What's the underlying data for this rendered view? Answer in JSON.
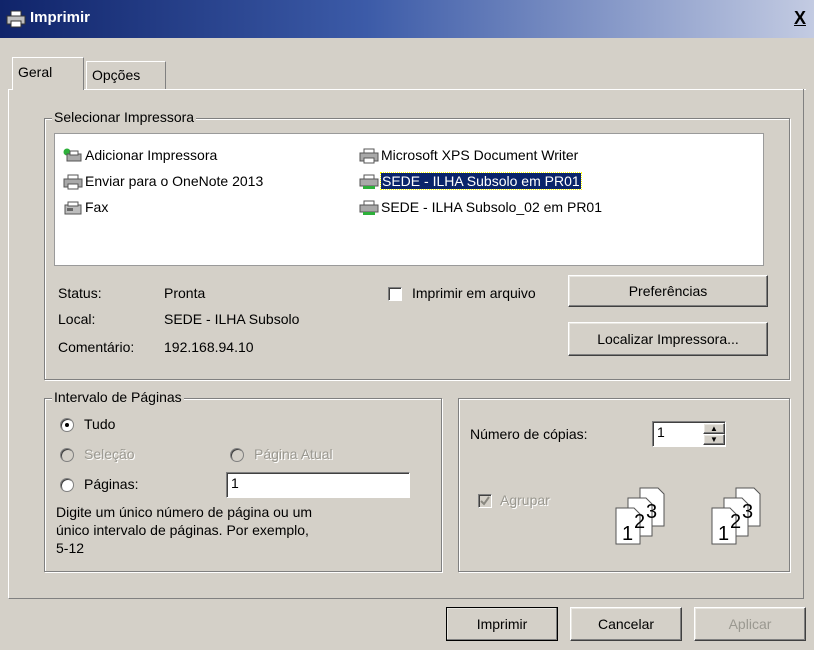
{
  "window": {
    "title": "Imprimir",
    "close_label": "X"
  },
  "tabs": [
    {
      "label": "Geral",
      "active": true
    },
    {
      "label": "Opções",
      "active": false
    }
  ],
  "printer_group": {
    "label": "Selecionar Impressora",
    "printers": [
      {
        "name": "Adicionar Impressora",
        "icon": "add-printer-icon",
        "selected": false
      },
      {
        "name": "Enviar para o OneNote 2013",
        "icon": "printer-icon",
        "selected": false
      },
      {
        "name": "Fax",
        "icon": "fax-icon",
        "selected": false
      },
      {
        "name": "Microsoft XPS Document Writer",
        "icon": "printer-icon",
        "selected": false
      },
      {
        "name": "SEDE - ILHA Subsolo em PR01",
        "icon": "network-printer-icon",
        "selected": true
      },
      {
        "name": "SEDE - ILHA Subsolo_02 em PR01",
        "icon": "network-printer-icon",
        "selected": false
      }
    ],
    "status_label": "Status:",
    "status_value": "Pronta",
    "local_label": "Local:",
    "local_value": "SEDE - ILHA Subsolo",
    "comment_label": "Comentário:",
    "comment_value": "192.168.94.10",
    "print_to_file_label": "Imprimir em arquivo",
    "print_to_file_checked": false,
    "preferences_label": "Preferências",
    "find_printer_label": "Localizar Impressora..."
  },
  "page_range": {
    "label": "Intervalo de Páginas",
    "all_label": "Tudo",
    "selection_label": "Seleção",
    "current_page_label": "Página Atual",
    "pages_label": "Páginas:",
    "pages_value": "1",
    "selected_option": "all",
    "help_line1": "Digite um único número de página ou um",
    "help_line2": "único intervalo de páginas. Por exemplo,",
    "help_line3": "5-12"
  },
  "copies": {
    "label": "Número de cópias:",
    "value": "1",
    "collate_label": "Agrupar",
    "collate_checked": true,
    "collate_enabled": false,
    "collate_digits": [
      "1",
      "2",
      "3"
    ]
  },
  "footer": {
    "print_label": "Imprimir",
    "cancel_label": "Cancelar",
    "apply_label": "Aplicar"
  },
  "colors": {
    "title_bar": "#10246a",
    "selection": "#0a246a",
    "dialog_bg": "#d4d0c8"
  }
}
